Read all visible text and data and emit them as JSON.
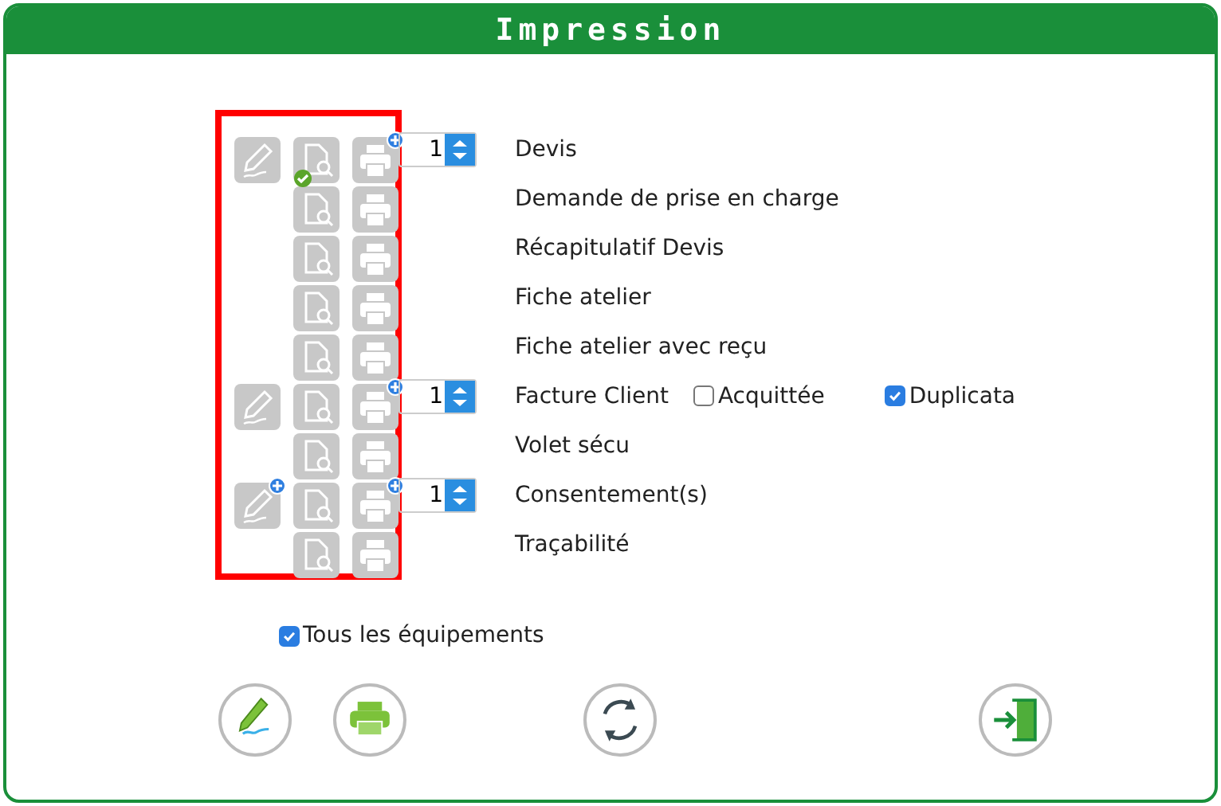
{
  "window": {
    "title": "Impression"
  },
  "documents": [
    {
      "label": "Devis",
      "sign_icon": true,
      "sign_plus": false,
      "preview_checked": true,
      "print_plus": true,
      "copies": "1"
    },
    {
      "label": "Demande de prise en charge",
      "sign_icon": false,
      "preview_checked": false,
      "print_plus": false
    },
    {
      "label": "Récapitulatif Devis",
      "sign_icon": false,
      "preview_checked": false,
      "print_plus": false
    },
    {
      "label": "Fiche atelier",
      "sign_icon": false,
      "preview_checked": false,
      "print_plus": false
    },
    {
      "label": "Fiche atelier avec reçu",
      "sign_icon": false,
      "preview_checked": false,
      "print_plus": false
    },
    {
      "label": "Facture Client",
      "sign_icon": true,
      "sign_plus": false,
      "preview_checked": false,
      "print_plus": true,
      "copies": "1",
      "options": [
        {
          "label": "Acquittée",
          "checked": false
        },
        {
          "label": "Duplicata",
          "checked": true
        }
      ]
    },
    {
      "label": "Volet sécu",
      "sign_icon": false,
      "preview_checked": false,
      "print_plus": false
    },
    {
      "label": "Consentement(s)",
      "sign_icon": true,
      "sign_plus": true,
      "preview_checked": false,
      "print_plus": true,
      "copies": "1"
    },
    {
      "label": "Traçabilité",
      "sign_icon": false,
      "preview_checked": false,
      "print_plus": false
    }
  ],
  "all_equipment": {
    "label": "Tous les équipements",
    "checked": true
  },
  "actions": [
    {
      "kind": "sign"
    },
    {
      "kind": "print"
    },
    {
      "kind": "refresh"
    },
    {
      "kind": "exit"
    }
  ]
}
